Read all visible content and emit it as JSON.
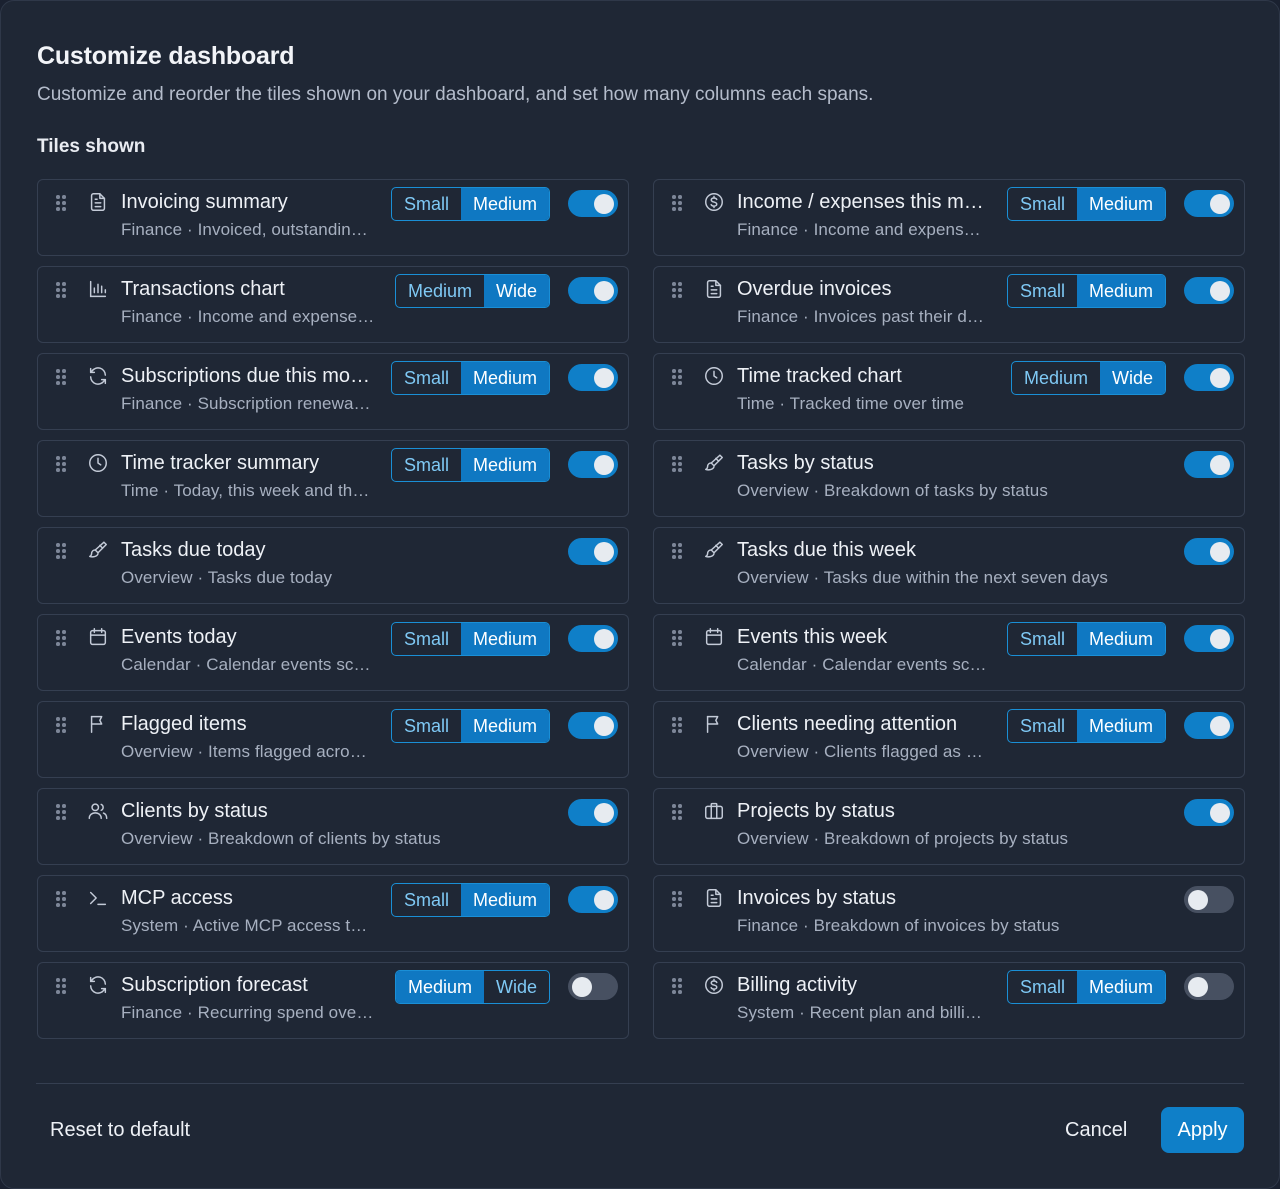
{
  "dialog": {
    "title": "Customize dashboard",
    "subtitle": "Customize and reorder the tiles shown on your dashboard, and set how many columns each spans.",
    "section_label": "Tiles shown"
  },
  "colors": {
    "accent": "#0f7fc8",
    "segment_active": "#0f78c2",
    "segment_text": "#7fc9f5",
    "toggle_off": "#475061",
    "background": "#1f2735"
  },
  "tiles": [
    {
      "name": "Invoicing summary",
      "desc": "Finance · Invoiced, outstandin…",
      "icon": "document-icon",
      "sizes": [
        "Small",
        "Medium"
      ],
      "selected": "Medium",
      "enabled": true
    },
    {
      "name": "Income / expenses this m…",
      "desc": "Finance · Income and expens…",
      "icon": "dollar-circle-icon",
      "sizes": [
        "Small",
        "Medium"
      ],
      "selected": "Medium",
      "enabled": true
    },
    {
      "name": "Transactions chart",
      "desc": "Finance · Income and expense…",
      "icon": "bar-chart-icon",
      "sizes": [
        "Medium",
        "Wide"
      ],
      "selected": "Wide",
      "enabled": true
    },
    {
      "name": "Overdue invoices",
      "desc": "Finance · Invoices past their d…",
      "icon": "document-icon",
      "sizes": [
        "Small",
        "Medium"
      ],
      "selected": "Medium",
      "enabled": true
    },
    {
      "name": "Subscriptions due this mo…",
      "desc": "Finance · Subscription renewa…",
      "icon": "refresh-icon",
      "sizes": [
        "Small",
        "Medium"
      ],
      "selected": "Medium",
      "enabled": true
    },
    {
      "name": "Time tracked chart",
      "desc": "Time · Tracked time over time",
      "icon": "clock-icon",
      "sizes": [
        "Medium",
        "Wide"
      ],
      "selected": "Wide",
      "enabled": true
    },
    {
      "name": "Time tracker summary",
      "desc": "Time · Today, this week and th…",
      "icon": "clock-icon",
      "sizes": [
        "Small",
        "Medium"
      ],
      "selected": "Medium",
      "enabled": true
    },
    {
      "name": "Tasks by status",
      "desc": "Overview · Breakdown of tasks by status",
      "icon": "paintbrush-icon",
      "sizes": [],
      "selected": "",
      "enabled": true
    },
    {
      "name": "Tasks due today",
      "desc": "Overview · Tasks due today",
      "icon": "paintbrush-icon",
      "sizes": [],
      "selected": "",
      "enabled": true
    },
    {
      "name": "Tasks due this week",
      "desc": "Overview · Tasks due within the next seven days",
      "icon": "paintbrush-icon",
      "sizes": [],
      "selected": "",
      "enabled": true
    },
    {
      "name": "Events today",
      "desc": "Calendar · Calendar events sc…",
      "icon": "calendar-icon",
      "sizes": [
        "Small",
        "Medium"
      ],
      "selected": "Medium",
      "enabled": true
    },
    {
      "name": "Events this week",
      "desc": "Calendar · Calendar events sc…",
      "icon": "calendar-icon",
      "sizes": [
        "Small",
        "Medium"
      ],
      "selected": "Medium",
      "enabled": true
    },
    {
      "name": "Flagged items",
      "desc": "Overview · Items flagged acro…",
      "icon": "flag-icon",
      "sizes": [
        "Small",
        "Medium"
      ],
      "selected": "Medium",
      "enabled": true
    },
    {
      "name": "Clients needing attention",
      "desc": "Overview · Clients flagged as …",
      "icon": "flag-icon",
      "sizes": [
        "Small",
        "Medium"
      ],
      "selected": "Medium",
      "enabled": true
    },
    {
      "name": "Clients by status",
      "desc": "Overview · Breakdown of clients by status",
      "icon": "users-icon",
      "sizes": [],
      "selected": "",
      "enabled": true
    },
    {
      "name": "Projects by status",
      "desc": "Overview · Breakdown of projects by status",
      "icon": "briefcase-icon",
      "sizes": [],
      "selected": "",
      "enabled": true
    },
    {
      "name": "MCP access",
      "desc": "System · Active MCP access t…",
      "icon": "terminal-icon",
      "sizes": [
        "Small",
        "Medium"
      ],
      "selected": "Medium",
      "enabled": true
    },
    {
      "name": "Invoices by status",
      "desc": "Finance · Breakdown of invoices by status",
      "icon": "document-icon",
      "sizes": [],
      "selected": "",
      "enabled": false
    },
    {
      "name": "Subscription forecast",
      "desc": "Finance · Recurring spend ove…",
      "icon": "refresh-icon",
      "sizes": [
        "Medium",
        "Wide"
      ],
      "selected": "Medium",
      "enabled": false
    },
    {
      "name": "Billing activity",
      "desc": "System · Recent plan and billi…",
      "icon": "dollar-circle-icon",
      "sizes": [
        "Small",
        "Medium"
      ],
      "selected": "Medium",
      "enabled": false
    }
  ],
  "footer": {
    "reset_label": "Reset to default",
    "cancel_label": "Cancel",
    "apply_label": "Apply"
  }
}
